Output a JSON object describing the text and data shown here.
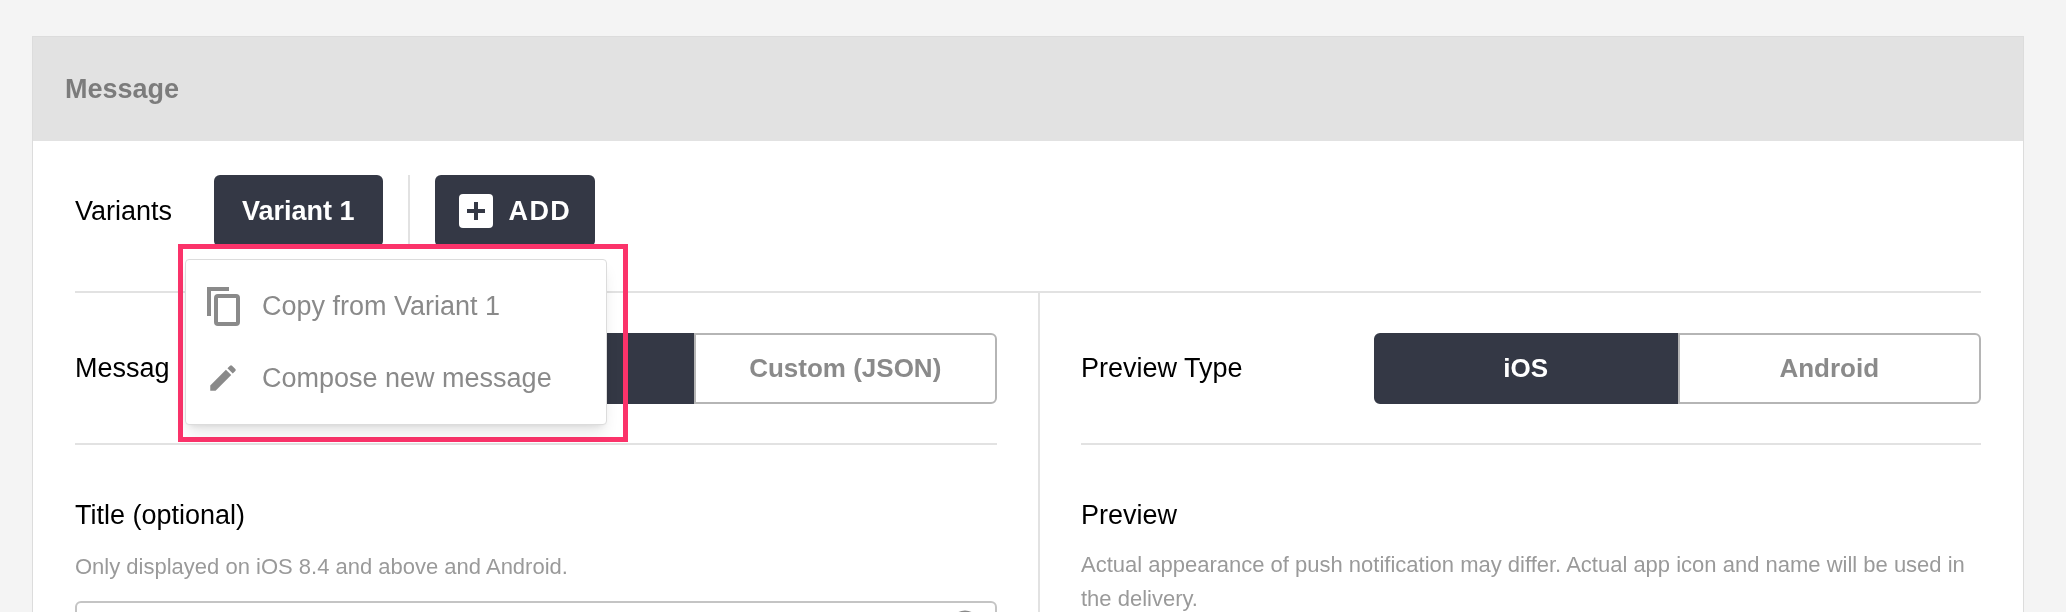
{
  "panel": {
    "title": "Message"
  },
  "variants": {
    "label": "Variants",
    "items": [
      {
        "label": "Variant 1",
        "selected": true
      }
    ],
    "add_button": "ADD"
  },
  "add_menu": {
    "highlighted": true,
    "items": [
      {
        "label": "Copy from Variant 1",
        "kind": "copy"
      },
      {
        "label": "Compose new message",
        "kind": "compose"
      }
    ]
  },
  "message_type": {
    "label": "Messag",
    "options": [
      {
        "selected": true
      },
      {
        "label": "Custom (JSON)",
        "selected": false
      }
    ]
  },
  "title_field": {
    "label": "Title (optional)",
    "hint": "Only displayed on iOS 8.4 and above and Android."
  },
  "preview_type": {
    "label": "Preview Type",
    "options": [
      {
        "label": "iOS",
        "selected": true
      },
      {
        "label": "Android",
        "selected": false
      }
    ]
  },
  "preview": {
    "label": "Preview",
    "description": "Actual appearance of push notification may differ. Actual app icon and name will be used in the delivery."
  }
}
